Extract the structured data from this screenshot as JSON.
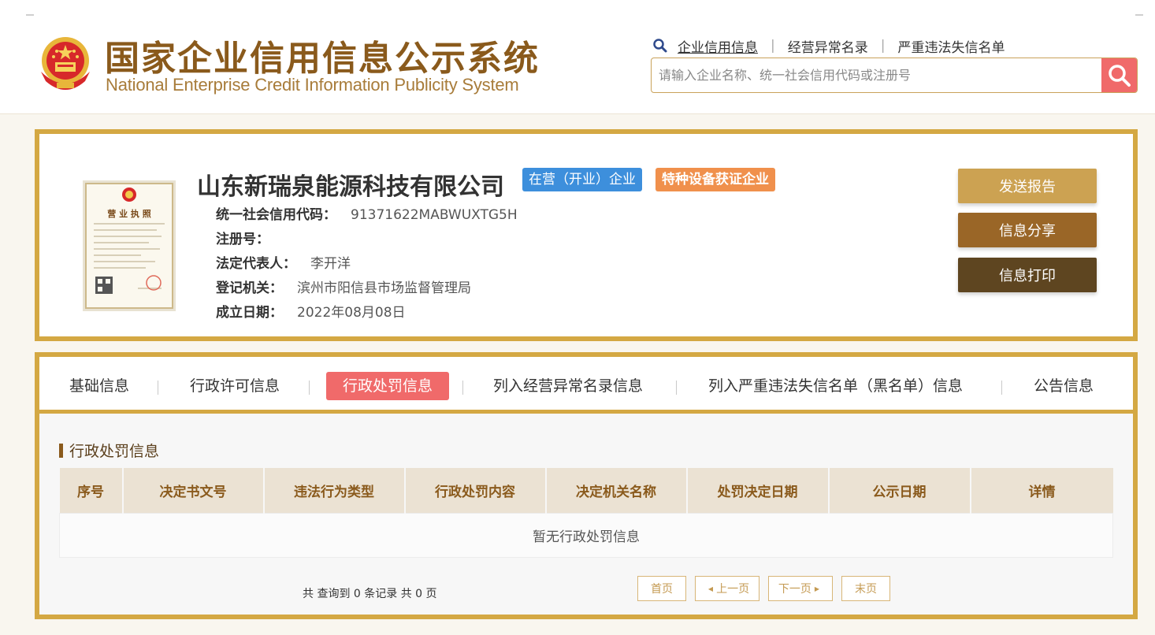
{
  "header": {
    "title_cn": "国家企业信用信息公示系统",
    "title_en": "National Enterprise Credit Information Publicity System",
    "links": [
      "企业信用信息",
      "经营异常名录",
      "严重违法失信名单"
    ],
    "search_placeholder": "请输入企业名称、统一社会信用代码或注册号"
  },
  "company": {
    "name": "山东新瑞泉能源科技有限公司",
    "status_tag": "在营（开业）企业",
    "special_tag": "特种设备获证企业",
    "fields": [
      {
        "label": "统一社会信用代码：",
        "value": "91371622MABWUXTG5H"
      },
      {
        "label": "注册号：",
        "value": ""
      },
      {
        "label": "法定代表人：",
        "value": "李开洋"
      },
      {
        "label": "登记机关：",
        "value": "滨州市阳信县市场监督管理局"
      },
      {
        "label": "成立日期：",
        "value": "2022年08月08日"
      }
    ],
    "license_title": "营 业 执 照",
    "actions": {
      "report": "发送报告",
      "share": "信息分享",
      "print": "信息打印"
    }
  },
  "tabs": [
    "基础信息",
    "行政许可信息",
    "行政处罚信息",
    "列入经营异常名录信息",
    "列入严重违法失信名单（黑名单）信息",
    "公告信息"
  ],
  "active_tab": "行政处罚信息",
  "section": {
    "title": "行政处罚信息",
    "columns": [
      "序号",
      "决定书文号",
      "违法行为类型",
      "行政处罚内容",
      "决定机关名称",
      "处罚决定日期",
      "公示日期",
      "详情"
    ],
    "empty_text": "暂无行政处罚信息"
  },
  "pager": {
    "summary": "共 查询到 0 条记录 共 0 页",
    "first": "首页",
    "prev": "上一页",
    "next": "下一页",
    "last": "末页"
  },
  "colors": {
    "gold_border": "#d4a843",
    "active_tab": "#f06a6a",
    "status_tag": "#3d8fdc",
    "special_tag": "#f0904c",
    "btn_report": "#cca252",
    "btn_share": "#9a6627",
    "btn_print": "#5e4520"
  }
}
